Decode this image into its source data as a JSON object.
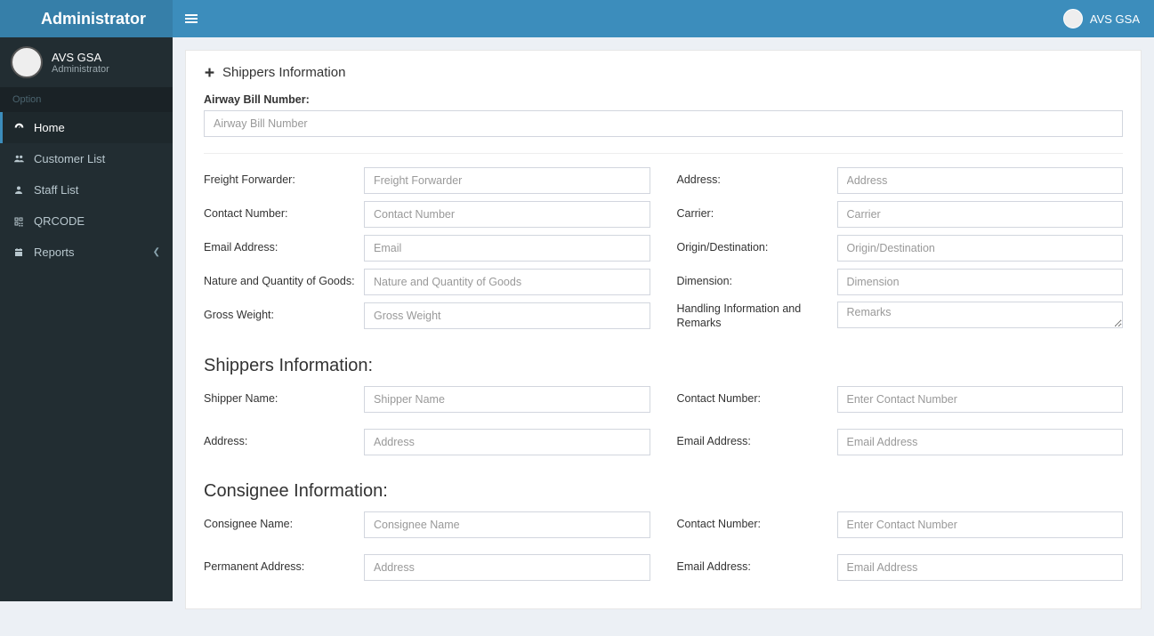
{
  "brand": "Administrator",
  "topUser": "AVS GSA",
  "profile": {
    "name": "AVS GSA",
    "role": "Administrator"
  },
  "sidebarHeader": "Option",
  "menu": {
    "home": "Home",
    "customers": "Customer List",
    "staff": "Staff List",
    "qrcode": "QRCODE",
    "reports": "Reports"
  },
  "form": {
    "title": "Shippers Information",
    "awb": {
      "label": "Airway Bill Number:",
      "placeholder": "Airway Bill Number"
    },
    "left": {
      "freight": {
        "label": "Freight Forwarder:",
        "placeholder": "Freight Forwarder"
      },
      "contact": {
        "label": "Contact Number:",
        "placeholder": "Contact Number"
      },
      "email": {
        "label": "Email Address:",
        "placeholder": "Email"
      },
      "nature": {
        "label": "Nature and Quantity of Goods:",
        "placeholder": "Nature and Quantity of Goods"
      },
      "gross": {
        "label": "Gross Weight:",
        "placeholder": "Gross Weight"
      }
    },
    "right": {
      "address": {
        "label": "Address:",
        "placeholder": "Address"
      },
      "carrier": {
        "label": "Carrier:",
        "placeholder": "Carrier"
      },
      "origin": {
        "label": "Origin/Destination:",
        "placeholder": "Origin/Destination"
      },
      "dimension": {
        "label": "Dimension:",
        "placeholder": "Dimension"
      },
      "remarks": {
        "label": "Handling Information and Remarks",
        "placeholder": "Remarks"
      }
    },
    "shippers": {
      "heading": "Shippers Information:",
      "name": {
        "label": "Shipper Name:",
        "placeholder": "Shipper Name"
      },
      "address": {
        "label": "Address:",
        "placeholder": "Address"
      },
      "contact": {
        "label": "Contact Number:",
        "placeholder": "Enter Contact Number"
      },
      "email": {
        "label": "Email Address:",
        "placeholder": "Email Address"
      }
    },
    "consignee": {
      "heading": "Consignee Information:",
      "name": {
        "label": "Consignee Name:",
        "placeholder": "Consignee Name"
      },
      "address": {
        "label": "Permanent Address:",
        "placeholder": "Address"
      },
      "contact": {
        "label": "Contact Number:",
        "placeholder": "Enter Contact Number"
      },
      "email": {
        "label": "Email Address:",
        "placeholder": "Email Address"
      }
    }
  }
}
